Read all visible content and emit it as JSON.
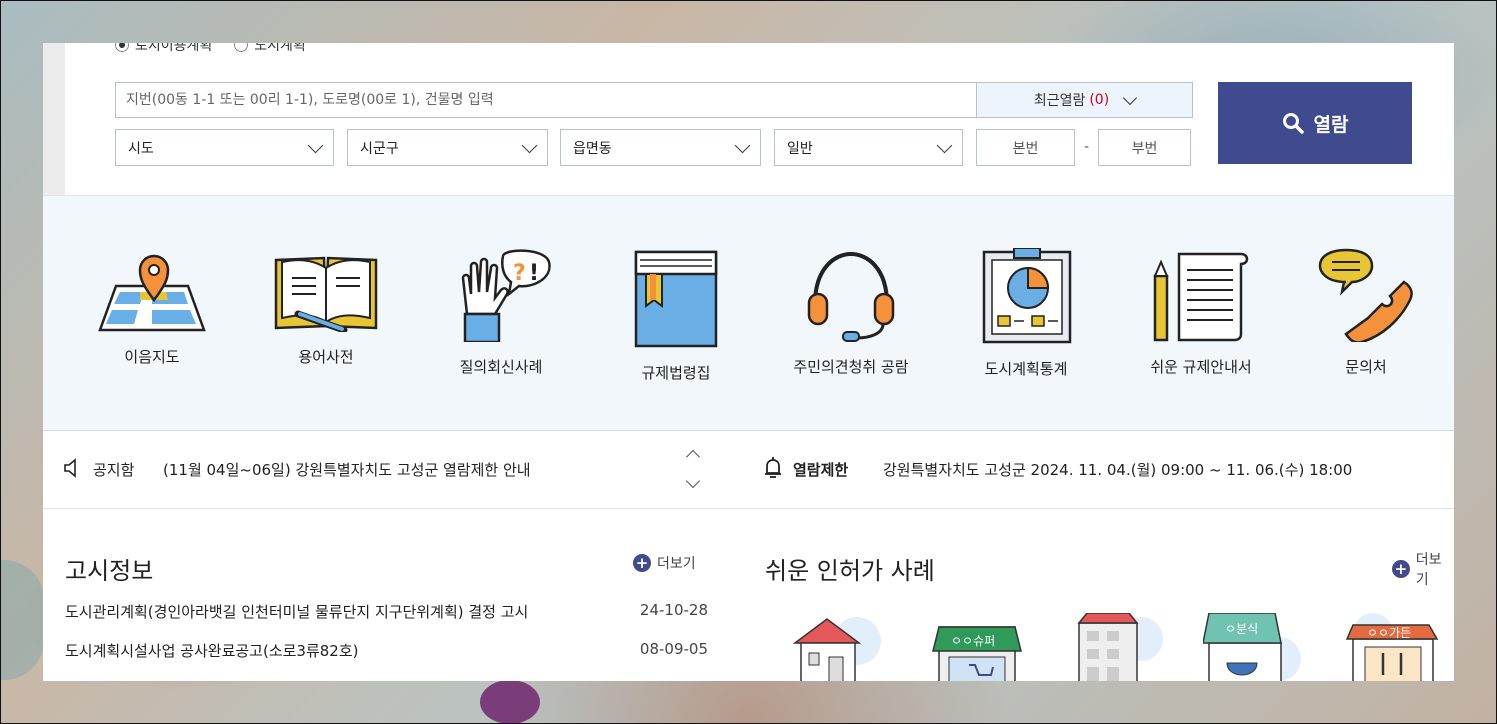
{
  "search": {
    "radios": [
      {
        "label": "토지이용계획",
        "checked": true
      },
      {
        "label": "도시계획",
        "checked": false
      }
    ],
    "address_placeholder": "지번(00동 1-1 또는 00리 1-1), 도로명(00로 1), 건물명 입력",
    "recent_label": "최근열람",
    "recent_count": "(0)",
    "selects": [
      "시도",
      "시군구",
      "읍면동",
      "일반"
    ],
    "main_number_placeholder": "본번",
    "dash": "-",
    "sub_number_placeholder": "부번",
    "open_button": "열람"
  },
  "shortcuts": [
    {
      "label": "이음지도",
      "icon": "map-pin-icon"
    },
    {
      "label": "용어사전",
      "icon": "open-book-icon"
    },
    {
      "label": "질의회신사례",
      "icon": "raised-hand-question-icon"
    },
    {
      "label": "규제법령집",
      "icon": "law-book-icon"
    },
    {
      "label": "주민의견청취 공람",
      "icon": "headset-icon"
    },
    {
      "label": "도시계획통계",
      "icon": "pie-chart-board-icon"
    },
    {
      "label": "쉬운 규제안내서",
      "icon": "scroll-pencil-icon"
    },
    {
      "label": "문의처",
      "icon": "phone-chat-icon"
    }
  ],
  "notice": {
    "label": "공지함",
    "text": "(11월 04일~06일) 강원특별자치도 고성군 열람제한 안내",
    "restrict_label": "열람제한",
    "restrict_text": "강원특별자치도 고성군 2024. 11. 04.(월) 09:00 ~ 11. 06.(수) 18:00"
  },
  "announcements": {
    "title": "고시정보",
    "more": "더보기",
    "items": [
      {
        "title": "도시관리계획(경인아라뱃길 인천터미널 물류단지 지구단위계획) 결정 고시",
        "date": "24-10-28"
      },
      {
        "title": "도시계획시설사업 공사완료공고(소로3류82호)",
        "date": "08-09-05"
      }
    ]
  },
  "cases": {
    "title": "쉬운 인허가 사례",
    "more": "더보기",
    "signs": [
      "ㅇㅇ슈퍼",
      "ㅇ분식",
      "ㅇㅇ가든"
    ]
  },
  "colors": {
    "accent": "#3f4a8f",
    "orange": "#f5913a",
    "blue": "#6aaee6",
    "yellow": "#e8c532",
    "shortcut_bg": "#f2f7fc",
    "count_red": "#d0021b"
  }
}
